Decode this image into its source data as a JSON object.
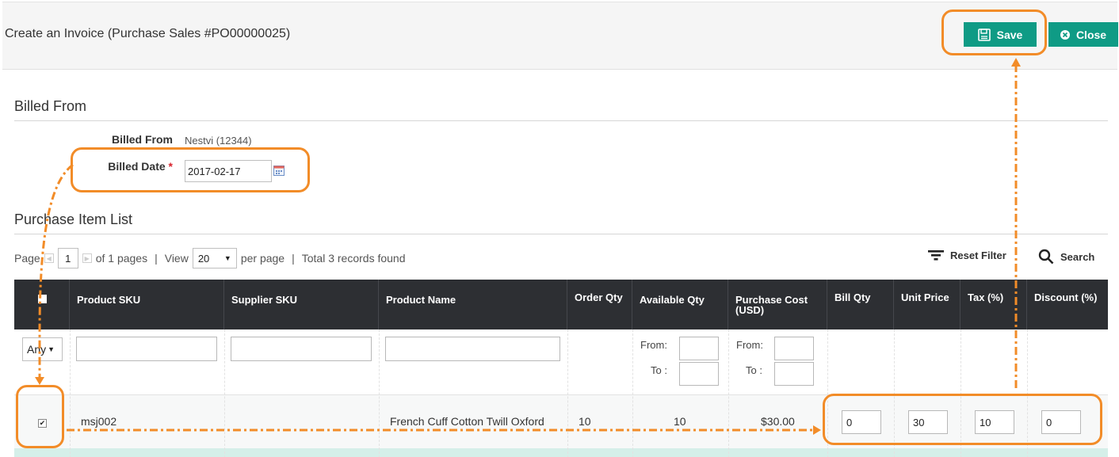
{
  "header": {
    "title": "Create an Invoice (Purchase Sales #PO00000025)",
    "save_label": "Save",
    "close_label": "Close"
  },
  "billed_from_section": {
    "title": "Billed From",
    "billed_from_label": "Billed From",
    "billed_from_value": "Nestvi (12344)",
    "billed_date_label": "Billed Date",
    "required_mark": "*",
    "billed_date_value": "2017-02-17"
  },
  "item_list": {
    "title": "Purchase Item List",
    "pager": {
      "page_label": "Page",
      "current_page": "1",
      "of_pages": "of 1 pages",
      "sep1": "|",
      "view_label": "View",
      "view_value": "20",
      "per_page": "per page",
      "sep2": "|",
      "total": "Total 3 records found"
    },
    "reset_filter_label": "Reset Filter",
    "search_label": "Search",
    "columns": [
      "Product SKU",
      "Supplier SKU",
      "Product Name",
      "Order Qty",
      "Available Qty",
      "Purchase Cost (USD)",
      "Bill Qty",
      "Unit Price",
      "Tax (%)",
      "Discount (%)"
    ],
    "filter": {
      "any_value": "Any",
      "from_label": "From:",
      "to_label": "To :"
    },
    "rows": [
      {
        "checked": true,
        "product_sku": "msj002",
        "supplier_sku": "",
        "product_name": "French Cuff Cotton Twill Oxford",
        "order_qty": "10",
        "available_qty": "10",
        "purchase_cost": "$30.00",
        "bill_qty": "0",
        "unit_price": "30",
        "tax": "10",
        "discount": "0"
      }
    ]
  },
  "colors": {
    "button": "#0f9b85",
    "header_row": "#2d2f33",
    "highlight": "#f28c28"
  }
}
